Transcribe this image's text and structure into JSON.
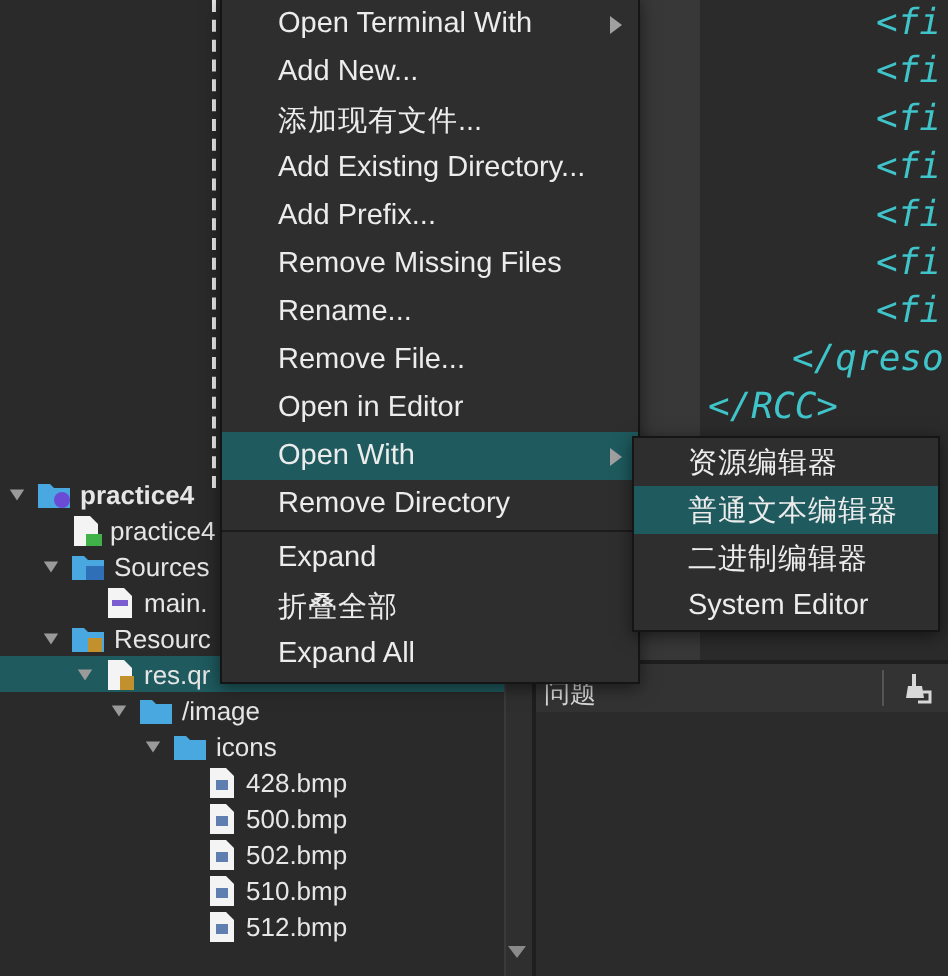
{
  "tree": [
    {
      "label": "practice4",
      "kind": "project",
      "expanded": true,
      "selected": false,
      "children": [
        {
          "label": "practice4",
          "kind": "pro-file",
          "selected": false
        },
        {
          "label": "Sources",
          "kind": "source-folder",
          "expanded": true,
          "selected": false,
          "children": [
            {
              "label": "main.",
              "kind": "cpp-file",
              "selected": false
            }
          ]
        },
        {
          "label": "Resourc",
          "kind": "resource-folder",
          "expanded": true,
          "selected": false,
          "children": [
            {
              "label": "res.qr",
              "kind": "qrc-file",
              "expanded": true,
              "selected": true,
              "children": [
                {
                  "label": "/image",
                  "kind": "folder",
                  "expanded": true,
                  "selected": false,
                  "children": [
                    {
                      "label": "icons",
                      "kind": "folder",
                      "expanded": true,
                      "selected": false,
                      "children": [
                        {
                          "label": "428.bmp",
                          "kind": "image-file",
                          "selected": false
                        },
                        {
                          "label": "500.bmp",
                          "kind": "image-file",
                          "selected": false
                        },
                        {
                          "label": "502.bmp",
                          "kind": "image-file",
                          "selected": false
                        },
                        {
                          "label": "510.bmp",
                          "kind": "image-file",
                          "selected": false
                        },
                        {
                          "label": "512.bmp",
                          "kind": "image-file",
                          "selected": false
                        }
                      ]
                    }
                  ]
                }
              ]
            }
          ]
        }
      ]
    }
  ],
  "code_lines": [
    {
      "text": "<fi",
      "kind": "file"
    },
    {
      "text": "<fi",
      "kind": "file"
    },
    {
      "text": "<fi",
      "kind": "file"
    },
    {
      "text": "<fi",
      "kind": "file"
    },
    {
      "text": "<fi",
      "kind": "file"
    },
    {
      "text": "<fi",
      "kind": "file"
    },
    {
      "text": "<fi",
      "kind": "file"
    },
    {
      "text": "</qreso",
      "kind": "qresource-close"
    },
    {
      "text": "</RCC>",
      "kind": "rcc-close"
    }
  ],
  "bottom_panel": {
    "title": "问题"
  },
  "context_menu": [
    {
      "kind": "item",
      "label": "Open Terminal With",
      "submenu": true,
      "selected": false
    },
    {
      "kind": "item",
      "label": "Add New...",
      "submenu": false,
      "selected": false
    },
    {
      "kind": "item",
      "label": "添加现有文件...",
      "submenu": false,
      "selected": false
    },
    {
      "kind": "item",
      "label": "Add Existing Directory...",
      "submenu": false,
      "selected": false
    },
    {
      "kind": "item",
      "label": "Add Prefix...",
      "submenu": false,
      "selected": false
    },
    {
      "kind": "item",
      "label": "Remove Missing Files",
      "submenu": false,
      "selected": false
    },
    {
      "kind": "item",
      "label": "Rename...",
      "submenu": false,
      "selected": false
    },
    {
      "kind": "item",
      "label": "Remove File...",
      "submenu": false,
      "selected": false
    },
    {
      "kind": "item",
      "label": "Open in Editor",
      "submenu": false,
      "selected": false
    },
    {
      "kind": "item",
      "label": "Open With",
      "submenu": true,
      "selected": true
    },
    {
      "kind": "item",
      "label": "Remove Directory",
      "submenu": false,
      "selected": false
    },
    {
      "kind": "separator"
    },
    {
      "kind": "item",
      "label": "Expand",
      "submenu": false,
      "selected": false
    },
    {
      "kind": "item",
      "label": "折叠全部",
      "submenu": false,
      "selected": false
    },
    {
      "kind": "item",
      "label": "Expand All",
      "submenu": false,
      "selected": false
    }
  ],
  "submenu": [
    {
      "label": "资源编辑器",
      "selected": false
    },
    {
      "label": "普通文本编辑器",
      "selected": true
    },
    {
      "label": "二进制编辑器",
      "selected": false
    },
    {
      "label": "System Editor",
      "selected": false
    }
  ]
}
